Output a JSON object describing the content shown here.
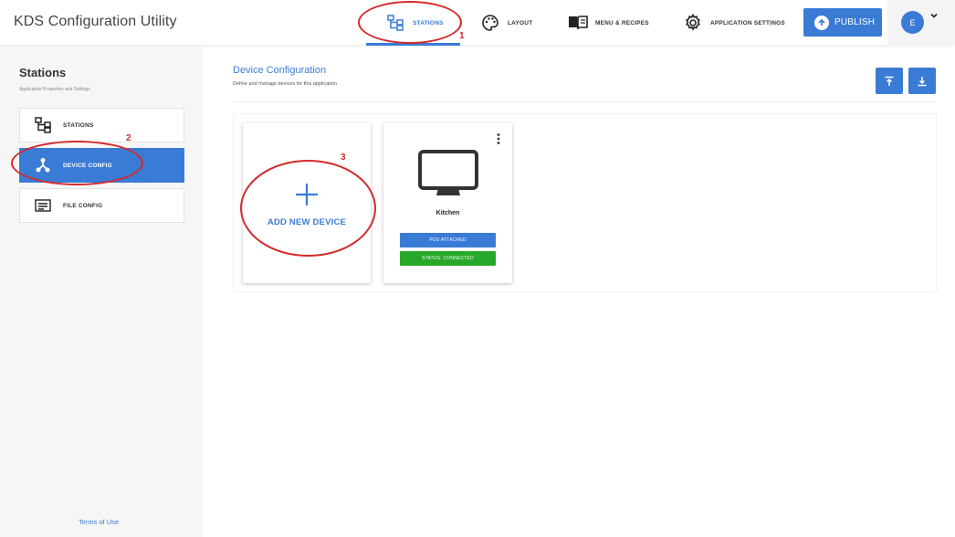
{
  "app": {
    "title": "KDS Configuration Utility"
  },
  "nav": {
    "tabs": [
      {
        "label": "STATIONS",
        "icon": "stations-icon",
        "active": true
      },
      {
        "label": "LAYOUT",
        "icon": "palette-icon",
        "active": false
      },
      {
        "label": "MENU & RECIPES",
        "icon": "book-icon",
        "active": false
      },
      {
        "label": "APPLICATION SETTINGS",
        "icon": "gear-icon",
        "active": false
      }
    ],
    "publish_label": "PUBLISH",
    "user_initial": "E"
  },
  "sidebar": {
    "title": "Stations",
    "subtitle": "Application Properties and Settings",
    "items": [
      {
        "label": "STATIONS",
        "icon": "stations-icon",
        "active": false
      },
      {
        "label": "DEVICE CONFIG",
        "icon": "device-config-icon",
        "active": true
      },
      {
        "label": "FILE CONFIG",
        "icon": "file-config-icon",
        "active": false
      }
    ],
    "terms_label": "Terms of Use"
  },
  "main": {
    "title": "Device Configuration",
    "subtitle": "Define and manage devices for this application",
    "add_device_label": "ADD NEW DEVICE",
    "devices": [
      {
        "name": "Kitchen",
        "pos_label": "POS ATTACHED",
        "status_label": "STATUS: CONNECTED"
      }
    ]
  },
  "annotations": [
    "1",
    "2",
    "3"
  ],
  "colors": {
    "accent": "#3a7bd5",
    "status_connected": "#27a82a",
    "annotation": "#d42a2a"
  }
}
